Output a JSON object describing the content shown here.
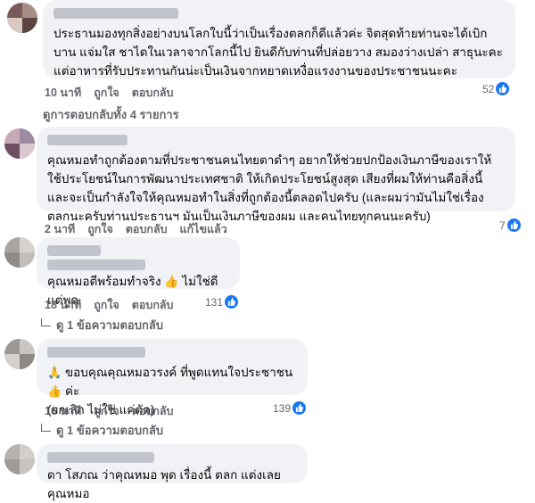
{
  "comments": [
    {
      "text": "ประธานมองทุกสิ่งอย่างบนโลกใบนี้ว่าเป็นเรื่องตลกก็ดีแล้วค่ะ จิตสุดท้ายท่านจะได้เบิกบาน แจ่มใส ชาไดในเวลาจากโลกนี้ไป ยินดีกับท่านที่ปล่อยวาง สมองว่างเปล่า สาธุนะคะ แต่อาหารที่รับประทานกันน่ะเป็นเงินจากหยาดเหงื่อแรงงานของประชาชนนะคะ",
      "time": "10 นาที",
      "like": "ถูกใจ",
      "reply": "ตอบกลับ",
      "reactions": "52",
      "replies_link": "ดูการตอบกลับทั้ง 4 รายการ"
    },
    {
      "text": "คุณหมอทำถูกต้องตามที่ประชาชนคนไทยตาดำๆ อยากให้ช่วยปกป้องเงินภาษีของเราให้ใช้ประโยชน์ในการพัฒนาประเทศชาติ ให้เกิดประโยชน์สูงสุด เสียงที่ผมให้ท่านคือสิ่งนี้ และจะเป็นกำลังใจให้คุณหมอทำในสิ่งที่ถูกต้องนี้ตลอดไปครับ (และผมว่ามันไม่ใช่เรื่องตลกนะครับท่านประธานฯ มันเป็นเงินภาษีของผม และคนไทยทุกคนนะครับ)",
      "time": "2 นาที",
      "like": "ถูกใจ",
      "reply": "ตอบกลับ",
      "edited": "แก้ไขแล้ว",
      "reactions": "7"
    },
    {
      "text_a": "คุณหมอตีพร้อมทำจริง",
      "text_b": "ไม่ใช่ดีแต่พูด",
      "time": "18 นาที",
      "like": "ถูกใจ",
      "reply": "ตอบกลับ",
      "reactions": "131",
      "replies_link": "ดู 1 ข้อความตอบกลับ"
    },
    {
      "text_a": "ขอบคุณคุณหมอวรงค์ ที่พูดแทนใจประชาชน",
      "text_b": "ค่ะ",
      "text_c": "(ยกเลิก ไม่ใช่ แค่ตัด)",
      "time": "16 นาที",
      "like": "ถูกใจ",
      "reply": "ตอบกลับ",
      "reactions": "139",
      "replies_link": "ดู 1 ข้อความตอบกลับ"
    },
    {
      "text": "ดา โสภณ ว่าคุณหมอ พุด เรื่องนี้ ตลก แต่งเลยคุณหมอ"
    }
  ],
  "icons": {
    "like": "thumbs-up-icon",
    "praying": "praying-hands-icon",
    "thumb": "thumbs-up-emoji-icon"
  },
  "colors": {
    "bubble": "#f0f2f5",
    "like_blue": "#1877f2",
    "meta_gray": "#65676b"
  }
}
